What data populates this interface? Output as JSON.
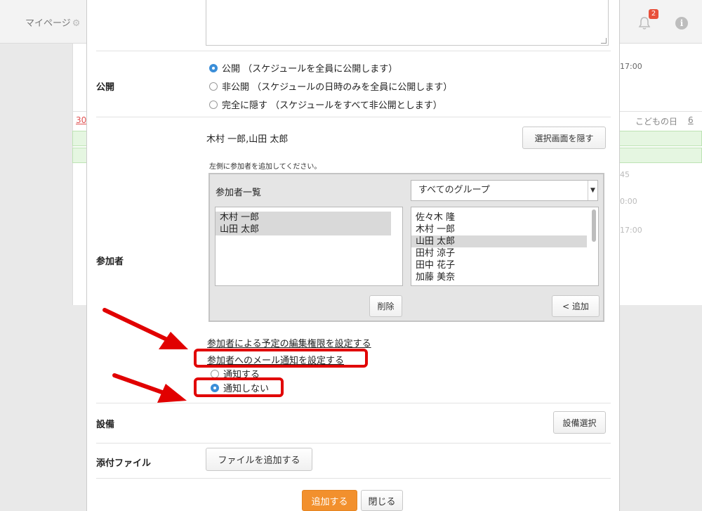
{
  "background": {
    "mypage_label": "マイページ",
    "notification_count": "2",
    "info_label": "i",
    "calendar": {
      "day_30": "30",
      "holiday_label": "こどもの日",
      "day_6": "6",
      "times_top": [
        "17:00"
      ],
      "times_mid": [
        "45",
        "0:00",
        "17:00"
      ]
    }
  },
  "form": {
    "visibility": {
      "label": "公開",
      "options": [
        {
          "label": "公開 （スケジュールを全員に公開します）",
          "checked": true
        },
        {
          "label": "非公開 （スケジュールの日時のみを全員に公開します）",
          "checked": false
        },
        {
          "label": "完全に隠す （スケジュールをすべて非公開とします）",
          "checked": false
        }
      ]
    },
    "participants": {
      "label": "参加者",
      "selected_summary": "木村 一郎,山田 太郎",
      "hide_selector_button": "選択画面を隠す",
      "instruction": "左側に参加者を追加してください。",
      "list_title": "参加者一覧",
      "group_select_value": "すべてのグループ",
      "selected_list": [
        "木村 一郎",
        "山田 太郎"
      ],
      "available_list": [
        {
          "name": "佐々木 隆",
          "selected": false
        },
        {
          "name": "木村 一郎",
          "selected": false
        },
        {
          "name": "山田 太郎",
          "selected": true
        },
        {
          "name": "田村 涼子",
          "selected": false
        },
        {
          "name": "田中 花子",
          "selected": false
        },
        {
          "name": "加藤 美奈",
          "selected": false
        }
      ],
      "delete_button": "削除",
      "add_button": "< 追加",
      "edit_permission_link": "参加者による予定の編集権限を設定する",
      "mail_notification_link": "参加者へのメール通知を設定する",
      "notify_options": [
        {
          "label": "通知する",
          "checked": false
        },
        {
          "label": "通知しない",
          "checked": true
        }
      ]
    },
    "equipment": {
      "label": "設備",
      "select_button": "設備選択"
    },
    "attachment": {
      "label": "添付ファイル",
      "add_file_button": "ファイルを追加する"
    },
    "footer": {
      "submit_button": "追加する",
      "close_button": "閉じる"
    }
  },
  "colors": {
    "accent_orange": "#f2902d",
    "radio_blue": "#3b8ed8",
    "annotation_red": "#e10000"
  }
}
